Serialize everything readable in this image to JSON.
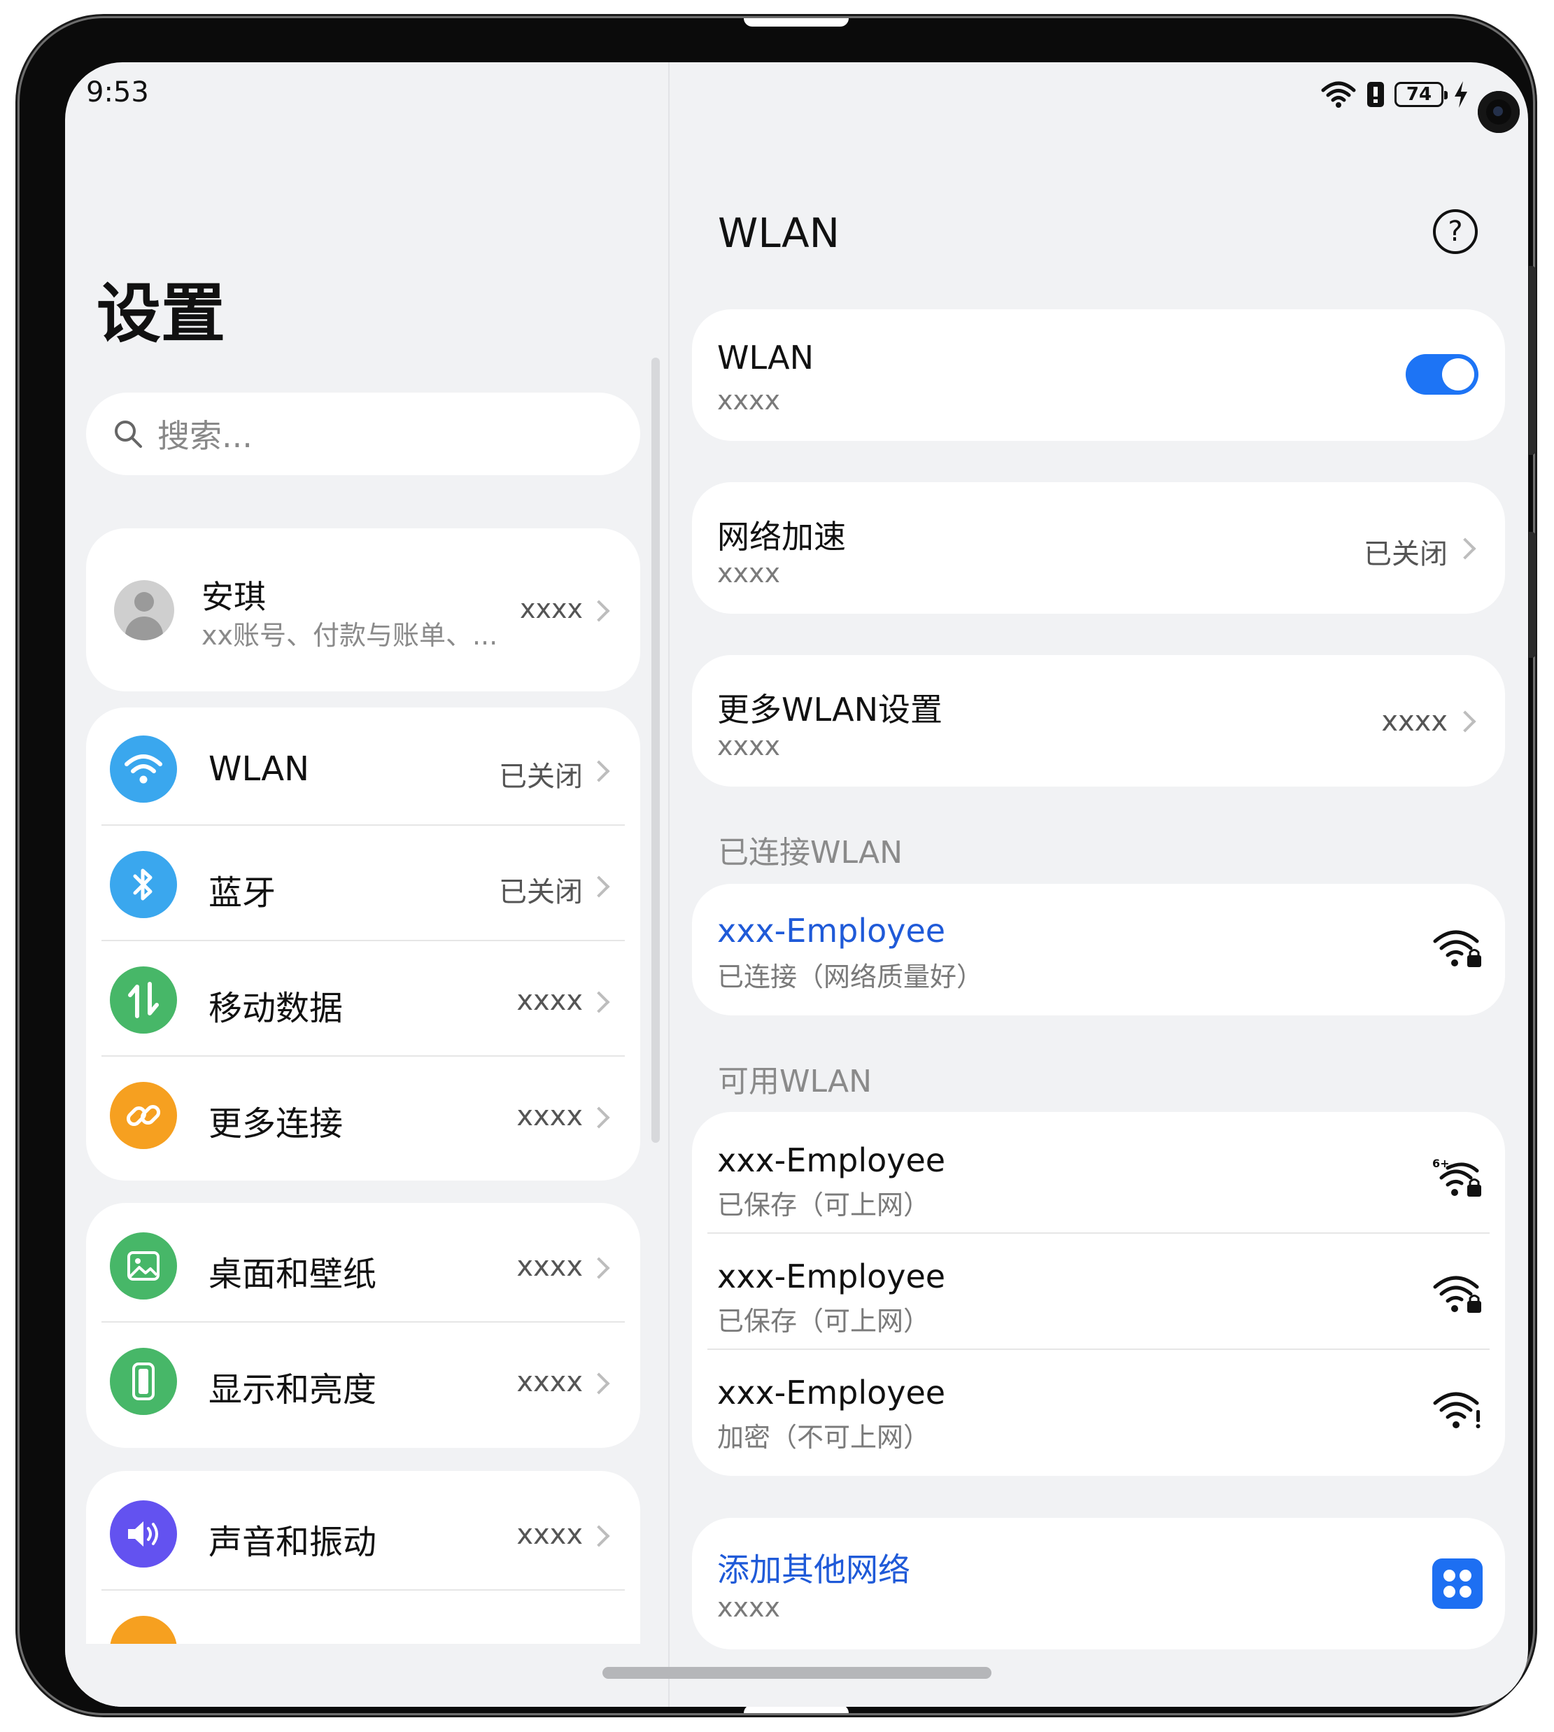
{
  "status": {
    "time": "9:53",
    "battery": "74"
  },
  "left": {
    "title": "设置",
    "search_placeholder": "搜索...",
    "profile": {
      "name": "安琪",
      "subtitle": "xx账号、付款与账单、...",
      "value": "xxxx"
    },
    "group1": [
      {
        "label": "WLAN",
        "value": "已关闭",
        "icon": "wifi-icon",
        "color": "#3aa7ee"
      },
      {
        "label": "蓝牙",
        "value": "已关闭",
        "icon": "bluetooth-icon",
        "color": "#3aa7ee"
      },
      {
        "label": "移动数据",
        "value": "xxxx",
        "icon": "mobile-data-icon",
        "color": "#47b768"
      },
      {
        "label": "更多连接",
        "value": "xxxx",
        "icon": "link-icon",
        "color": "#f6a020"
      }
    ],
    "group2": [
      {
        "label": "桌面和壁纸",
        "value": "xxxx",
        "icon": "wallpaper-icon",
        "color": "#47b768"
      },
      {
        "label": "显示和亮度",
        "value": "xxxx",
        "icon": "display-icon",
        "color": "#47b768"
      }
    ],
    "group3": [
      {
        "label": "声音和振动",
        "value": "xxxx",
        "icon": "sound-icon",
        "color": "#6352f0"
      }
    ]
  },
  "right": {
    "title": "WLAN",
    "wlan_card": {
      "title": "WLAN",
      "subtitle": "xxxx",
      "enabled": true
    },
    "accel_card": {
      "title": "网络加速",
      "subtitle": "xxxx",
      "value": "已关闭"
    },
    "more_card": {
      "title": "更多WLAN设置",
      "subtitle": "xxxx",
      "value": "xxxx"
    },
    "connected_label": "已连接WLAN",
    "connected": {
      "name": "xxx-Employee",
      "status": "已连接（网络质量好）"
    },
    "available_label": "可用WLAN",
    "available": [
      {
        "name": "xxx-Employee",
        "status": "已保存（可上网）",
        "icon": "wifi6-lock-icon"
      },
      {
        "name": "xxx-Employee",
        "status": "已保存（可上网）",
        "icon": "wifi-lock-icon"
      },
      {
        "name": "xxx-Employee",
        "status": "加密（不可上网）",
        "icon": "wifi-warning-icon"
      }
    ],
    "add_card": {
      "title": "添加其他网络",
      "subtitle": "xxxx"
    }
  }
}
